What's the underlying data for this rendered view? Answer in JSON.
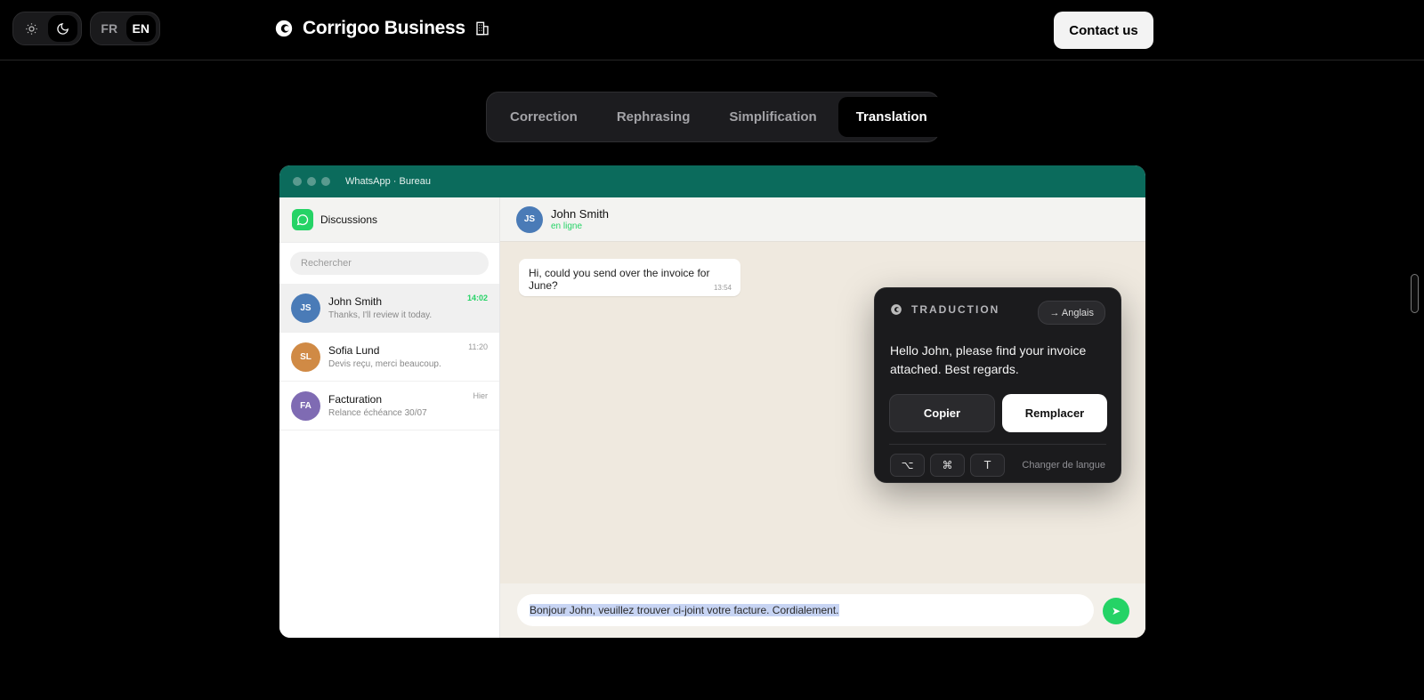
{
  "header": {
    "theme_toggle": {
      "light_icon": "sun-icon",
      "dark_icon": "moon-icon",
      "active": "dark"
    },
    "languages": [
      "FR",
      "EN"
    ],
    "active_language": "EN",
    "brand": {
      "name": "Corrigoo Business",
      "logo_icon": "corrigoo-logo-icon",
      "badge_icon": "building-icon"
    },
    "contact_label": "Contact us"
  },
  "tabs": [
    {
      "label": "Correction",
      "active": false
    },
    {
      "label": "Rephrasing",
      "active": false
    },
    {
      "label": "Simplification",
      "active": false
    },
    {
      "label": "Translation",
      "active": true
    }
  ],
  "window": {
    "title": "WhatsApp · Bureau",
    "sidebar": {
      "title": "Discussions",
      "search_placeholder": "Rechercher",
      "chats": [
        {
          "initials": "JS",
          "name": "John Smith",
          "preview": "Thanks, I'll review it today.",
          "time": "14:02",
          "unread": true,
          "color": "#4a7bb7"
        },
        {
          "initials": "SL",
          "name": "Sofia Lund",
          "preview": "Devis reçu, merci beaucoup.",
          "time": "11:20",
          "unread": false,
          "color": "#d08a45"
        },
        {
          "initials": "FA",
          "name": "Facturation",
          "preview": "Relance échéance 30/07",
          "time": "Hier",
          "unread": false,
          "color": "#7f6bb3"
        }
      ]
    },
    "conversation": {
      "contact_initials": "JS",
      "contact_name": "John Smith",
      "status": "en ligne",
      "message": {
        "text": "Hi, could you send over the invoice for June?",
        "time": "13:54"
      },
      "draft": "Bonjour John, veuillez trouver ci-joint votre facture. Cordialement."
    }
  },
  "popup": {
    "title": "TRADUCTION",
    "target_language": "→ Anglais",
    "result": "Hello John, please find your invoice attached. Best regards.",
    "copy_label": "Copier",
    "replace_label": "Remplacer",
    "shortcut_keys": [
      "⌥",
      "⌘",
      "T"
    ],
    "shortcut_hint": "Changer de langue"
  },
  "colors": {
    "whatsapp_teal": "#0b6b5c",
    "whatsapp_green": "#25d366",
    "page_bg": "#000000"
  }
}
